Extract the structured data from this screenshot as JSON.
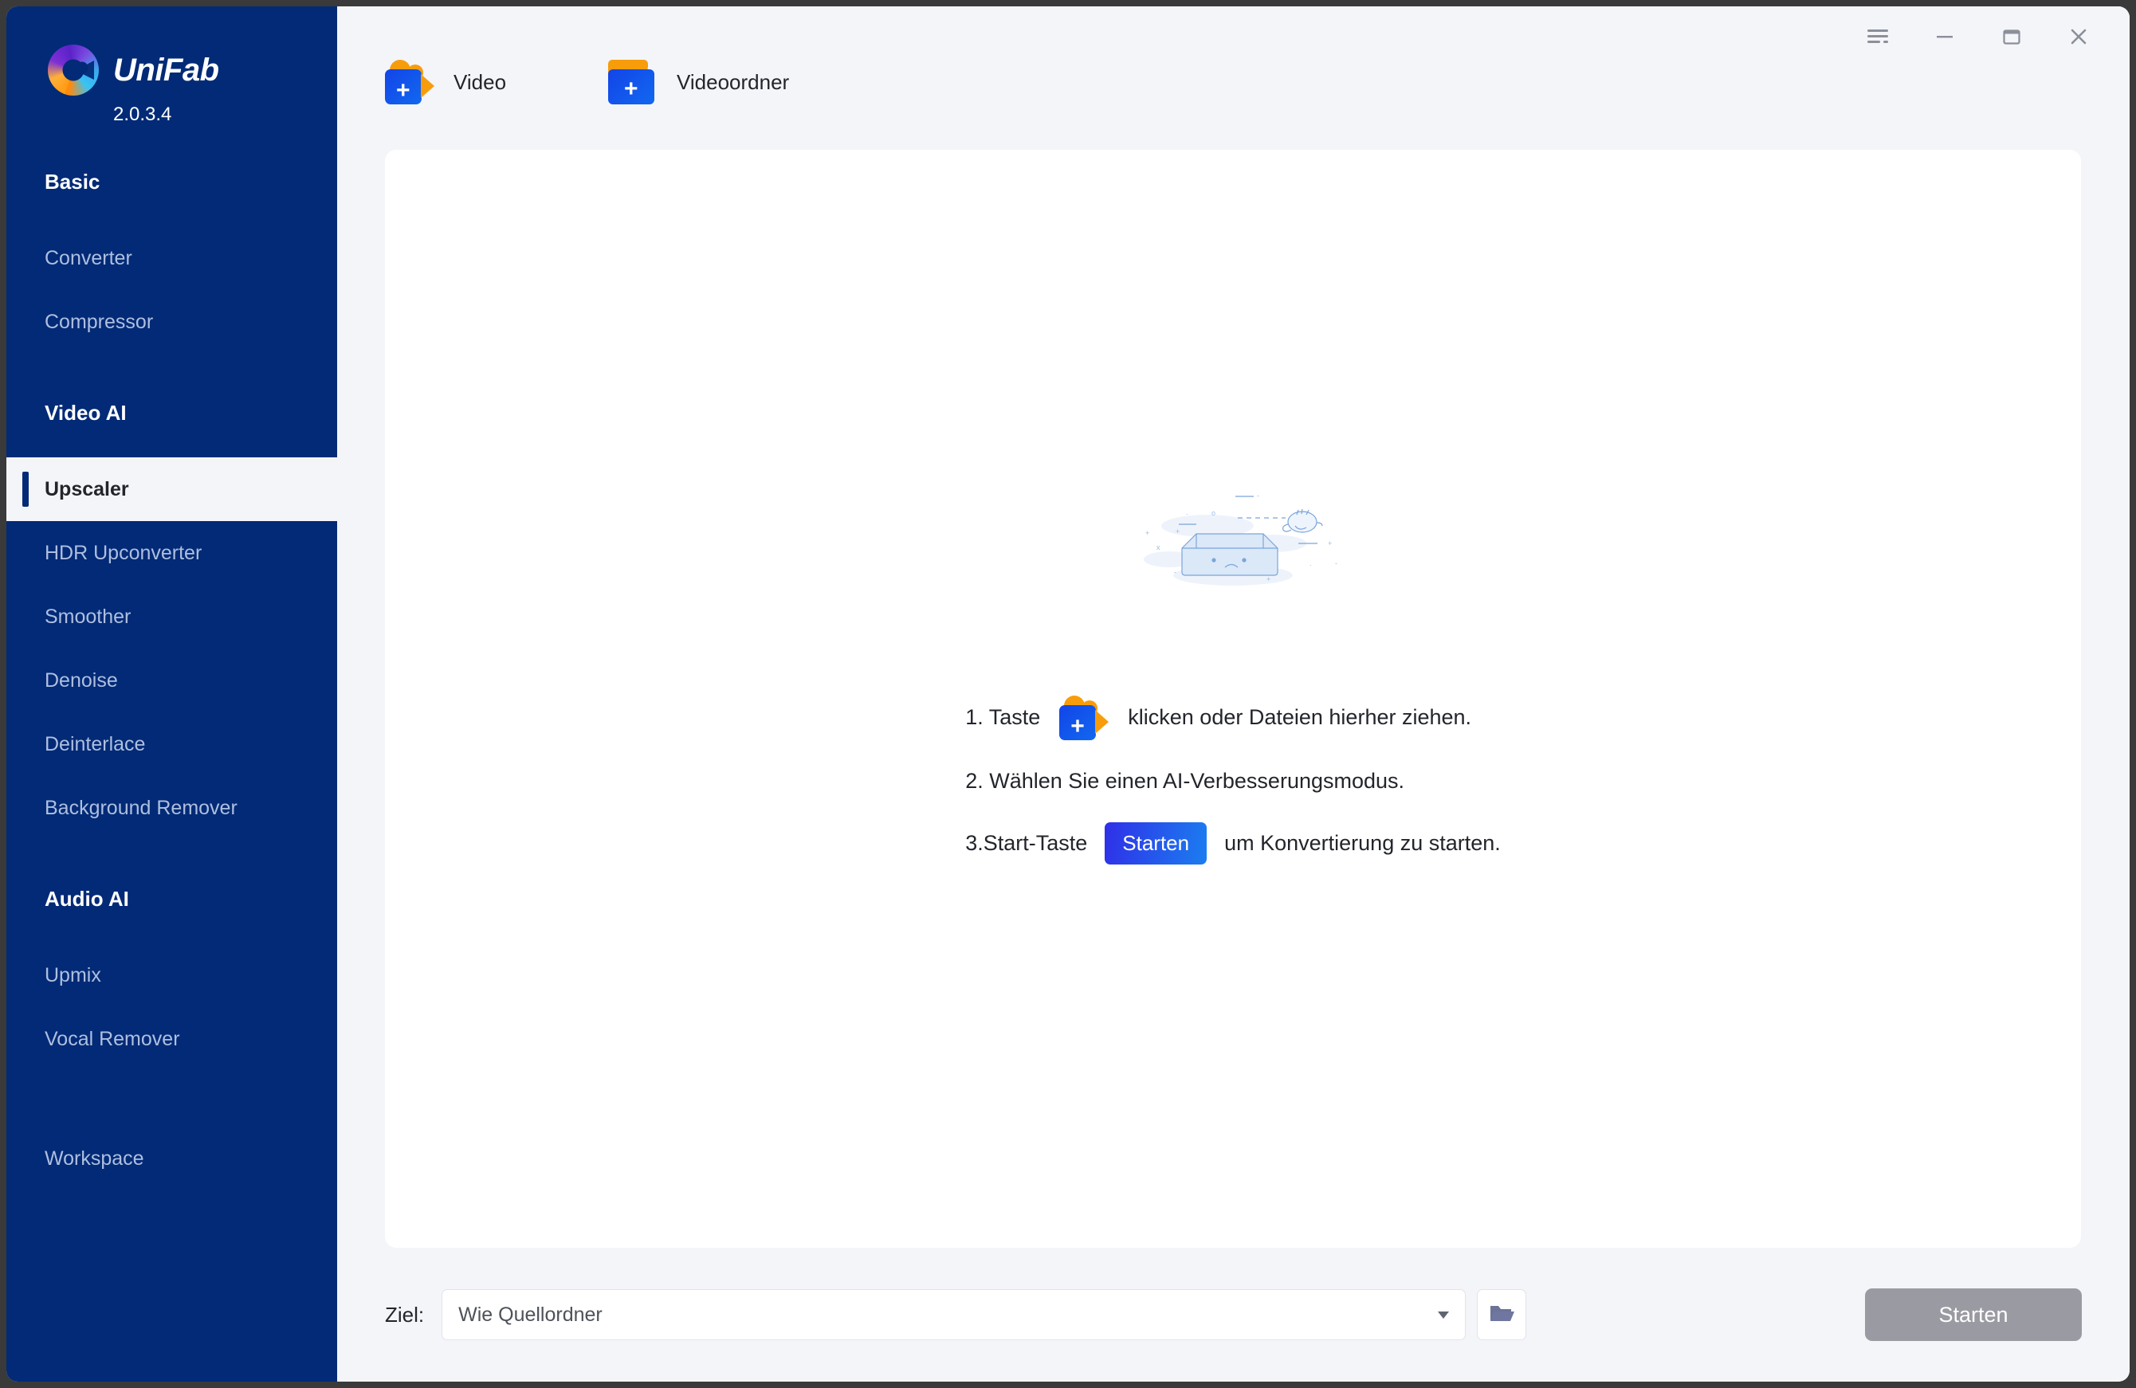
{
  "app": {
    "brand_name": "UniFab",
    "version": "2.0.3.4",
    "logo_icon": "unifab-logo-icon"
  },
  "titlebar": {
    "menu_icon": "hamburger-menu-icon",
    "minimize_icon": "minimize-icon",
    "maximize_icon": "maximize-icon",
    "close_icon": "close-icon"
  },
  "sidebar": {
    "sections": [
      {
        "title": "Basic",
        "items": [
          {
            "label": "Converter",
            "active": false
          },
          {
            "label": "Compressor",
            "active": false
          }
        ]
      },
      {
        "title": "Video AI",
        "items": [
          {
            "label": "Upscaler",
            "active": true
          },
          {
            "label": "HDR Upconverter",
            "active": false
          },
          {
            "label": "Smoother",
            "active": false
          },
          {
            "label": "Denoise",
            "active": false
          },
          {
            "label": "Deinterlace",
            "active": false
          },
          {
            "label": "Background Remover",
            "active": false
          }
        ]
      },
      {
        "title": "Audio AI",
        "items": [
          {
            "label": "Upmix",
            "active": false
          },
          {
            "label": "Vocal Remover",
            "active": false
          }
        ]
      }
    ],
    "workspace_label": "Workspace"
  },
  "toolbar": {
    "add_video_label": "Video",
    "add_video_icon": "add-video-icon",
    "add_folder_label": "Videoordner",
    "add_folder_icon": "add-video-folder-icon"
  },
  "main": {
    "empty_illustration": "empty-box-illustration",
    "steps": {
      "step1_prefix": "1. Taste",
      "step1_icon": "add-video-icon",
      "step1_suffix": "klicken oder Dateien hierher ziehen.",
      "step2": "2. Wählen Sie einen AI-Verbesserungsmodus.",
      "step3_prefix": "3.Start-Taste",
      "step3_button": "Starten",
      "step3_suffix": "um Konvertierung zu starten."
    }
  },
  "footer": {
    "destination_label": "Ziel:",
    "destination_value": "Wie Quellordner",
    "dropdown_icon": "chevron-down-icon",
    "browse_icon": "folder-open-icon",
    "start_button": "Starten"
  },
  "colors": {
    "sidebar_bg": "#022a76",
    "page_bg": "#f4f5f9",
    "card_bg": "#ffffff",
    "accent_blue": "#1344e8",
    "accent_orange": "#f79d0c",
    "disabled_grey": "#9a9ba2"
  }
}
